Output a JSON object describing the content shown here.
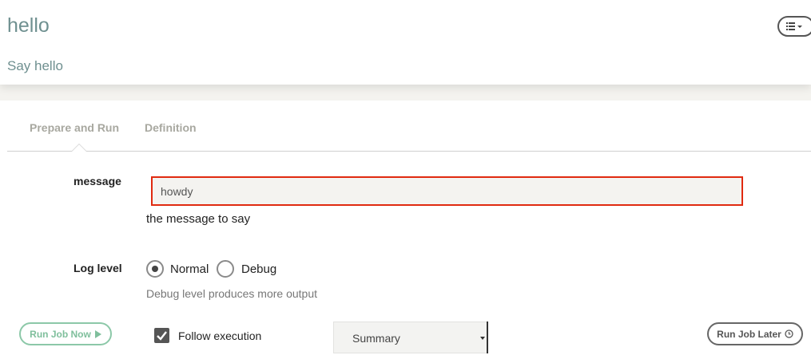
{
  "header": {
    "title": "hello",
    "description": "Say hello",
    "menu_icon": "list-menu-icon"
  },
  "tabs": [
    {
      "label": "Prepare and Run",
      "active": true
    },
    {
      "label": "Definition",
      "active": false
    }
  ],
  "options": {
    "message": {
      "label": "message",
      "value": "howdy",
      "description": "the message to say"
    },
    "log_level": {
      "label": "Log level",
      "choices": [
        {
          "label": "Normal",
          "selected": true
        },
        {
          "label": "Debug",
          "selected": false
        }
      ],
      "description": "Debug level produces more output"
    }
  },
  "footer": {
    "run_now_label": "Run Job Now",
    "follow_label": "Follow execution",
    "follow_checked": true,
    "follow_mode": "Summary",
    "run_later_label": "Run Job Later"
  },
  "colors": {
    "title": "#6f9090",
    "run_now": "#7fbf9c",
    "input_error_border": "#e02a10"
  }
}
